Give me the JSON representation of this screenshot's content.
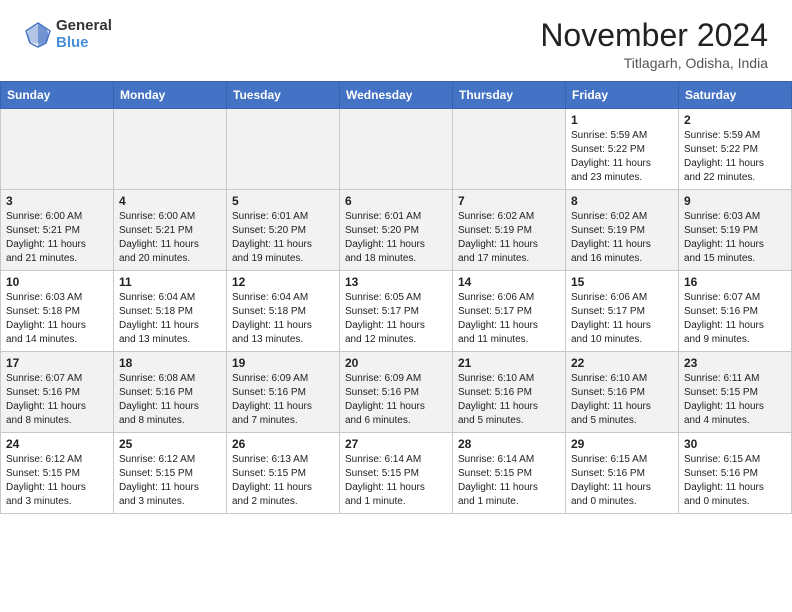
{
  "logo": {
    "general": "General",
    "blue": "Blue"
  },
  "title": "November 2024",
  "location": "Titlagarh, Odisha, India",
  "weekdays": [
    "Sunday",
    "Monday",
    "Tuesday",
    "Wednesday",
    "Thursday",
    "Friday",
    "Saturday"
  ],
  "weeks": [
    [
      {
        "day": "",
        "info": ""
      },
      {
        "day": "",
        "info": ""
      },
      {
        "day": "",
        "info": ""
      },
      {
        "day": "",
        "info": ""
      },
      {
        "day": "",
        "info": ""
      },
      {
        "day": "1",
        "info": "Sunrise: 5:59 AM\nSunset: 5:22 PM\nDaylight: 11 hours\nand 23 minutes."
      },
      {
        "day": "2",
        "info": "Sunrise: 5:59 AM\nSunset: 5:22 PM\nDaylight: 11 hours\nand 22 minutes."
      }
    ],
    [
      {
        "day": "3",
        "info": "Sunrise: 6:00 AM\nSunset: 5:21 PM\nDaylight: 11 hours\nand 21 minutes."
      },
      {
        "day": "4",
        "info": "Sunrise: 6:00 AM\nSunset: 5:21 PM\nDaylight: 11 hours\nand 20 minutes."
      },
      {
        "day": "5",
        "info": "Sunrise: 6:01 AM\nSunset: 5:20 PM\nDaylight: 11 hours\nand 19 minutes."
      },
      {
        "day": "6",
        "info": "Sunrise: 6:01 AM\nSunset: 5:20 PM\nDaylight: 11 hours\nand 18 minutes."
      },
      {
        "day": "7",
        "info": "Sunrise: 6:02 AM\nSunset: 5:19 PM\nDaylight: 11 hours\nand 17 minutes."
      },
      {
        "day": "8",
        "info": "Sunrise: 6:02 AM\nSunset: 5:19 PM\nDaylight: 11 hours\nand 16 minutes."
      },
      {
        "day": "9",
        "info": "Sunrise: 6:03 AM\nSunset: 5:19 PM\nDaylight: 11 hours\nand 15 minutes."
      }
    ],
    [
      {
        "day": "10",
        "info": "Sunrise: 6:03 AM\nSunset: 5:18 PM\nDaylight: 11 hours\nand 14 minutes."
      },
      {
        "day": "11",
        "info": "Sunrise: 6:04 AM\nSunset: 5:18 PM\nDaylight: 11 hours\nand 13 minutes."
      },
      {
        "day": "12",
        "info": "Sunrise: 6:04 AM\nSunset: 5:18 PM\nDaylight: 11 hours\nand 13 minutes."
      },
      {
        "day": "13",
        "info": "Sunrise: 6:05 AM\nSunset: 5:17 PM\nDaylight: 11 hours\nand 12 minutes."
      },
      {
        "day": "14",
        "info": "Sunrise: 6:06 AM\nSunset: 5:17 PM\nDaylight: 11 hours\nand 11 minutes."
      },
      {
        "day": "15",
        "info": "Sunrise: 6:06 AM\nSunset: 5:17 PM\nDaylight: 11 hours\nand 10 minutes."
      },
      {
        "day": "16",
        "info": "Sunrise: 6:07 AM\nSunset: 5:16 PM\nDaylight: 11 hours\nand 9 minutes."
      }
    ],
    [
      {
        "day": "17",
        "info": "Sunrise: 6:07 AM\nSunset: 5:16 PM\nDaylight: 11 hours\nand 8 minutes."
      },
      {
        "day": "18",
        "info": "Sunrise: 6:08 AM\nSunset: 5:16 PM\nDaylight: 11 hours\nand 8 minutes."
      },
      {
        "day": "19",
        "info": "Sunrise: 6:09 AM\nSunset: 5:16 PM\nDaylight: 11 hours\nand 7 minutes."
      },
      {
        "day": "20",
        "info": "Sunrise: 6:09 AM\nSunset: 5:16 PM\nDaylight: 11 hours\nand 6 minutes."
      },
      {
        "day": "21",
        "info": "Sunrise: 6:10 AM\nSunset: 5:16 PM\nDaylight: 11 hours\nand 5 minutes."
      },
      {
        "day": "22",
        "info": "Sunrise: 6:10 AM\nSunset: 5:16 PM\nDaylight: 11 hours\nand 5 minutes."
      },
      {
        "day": "23",
        "info": "Sunrise: 6:11 AM\nSunset: 5:15 PM\nDaylight: 11 hours\nand 4 minutes."
      }
    ],
    [
      {
        "day": "24",
        "info": "Sunrise: 6:12 AM\nSunset: 5:15 PM\nDaylight: 11 hours\nand 3 minutes."
      },
      {
        "day": "25",
        "info": "Sunrise: 6:12 AM\nSunset: 5:15 PM\nDaylight: 11 hours\nand 3 minutes."
      },
      {
        "day": "26",
        "info": "Sunrise: 6:13 AM\nSunset: 5:15 PM\nDaylight: 11 hours\nand 2 minutes."
      },
      {
        "day": "27",
        "info": "Sunrise: 6:14 AM\nSunset: 5:15 PM\nDaylight: 11 hours\nand 1 minute."
      },
      {
        "day": "28",
        "info": "Sunrise: 6:14 AM\nSunset: 5:15 PM\nDaylight: 11 hours\nand 1 minute."
      },
      {
        "day": "29",
        "info": "Sunrise: 6:15 AM\nSunset: 5:16 PM\nDaylight: 11 hours\nand 0 minutes."
      },
      {
        "day": "30",
        "info": "Sunrise: 6:15 AM\nSunset: 5:16 PM\nDaylight: 11 hours\nand 0 minutes."
      }
    ]
  ]
}
